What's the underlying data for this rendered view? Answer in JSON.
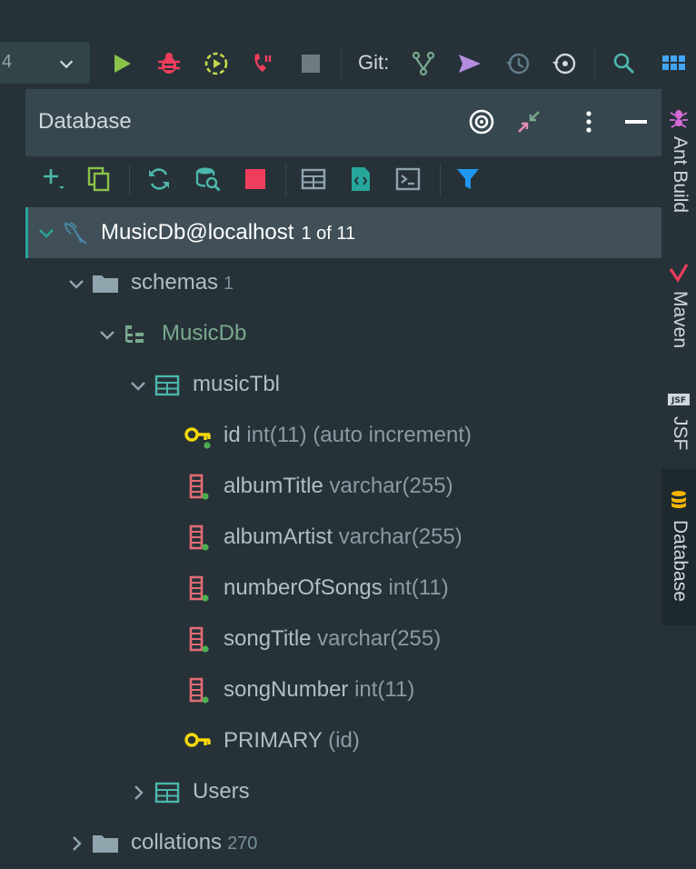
{
  "toolbar": {
    "run_config": "4",
    "git_label": "Git:",
    "icons": [
      "chevron-down-icon",
      "run-icon",
      "debug-icon",
      "coverage-icon",
      "profiler-icon",
      "stop-icon",
      "git-branch-icon",
      "git-push-icon",
      "history-icon",
      "revert-icon",
      "search-icon",
      "apps-grid-icon"
    ]
  },
  "panel": {
    "title": "Database",
    "header_icons": [
      "target-icon",
      "collapse-icon",
      "more-vertical-icon",
      "minimize-icon"
    ],
    "db_toolbar_icons": [
      "add-icon",
      "duplicate-icon",
      "refresh-icon",
      "schema-search-icon",
      "stop-icon",
      "table-view-icon",
      "ddl-file-icon",
      "console-icon",
      "filter-icon"
    ]
  },
  "tree": {
    "connection": {
      "name": "MusicDb@localhost",
      "count": "1 of 11"
    },
    "schemas": {
      "name": "schemas",
      "count": "1"
    },
    "schema": {
      "name": "MusicDb"
    },
    "table": {
      "name": "musicTbl"
    },
    "columns": [
      {
        "name": "id",
        "type": "int(11) (auto increment)",
        "icon": "key-icon"
      },
      {
        "name": "albumTitle",
        "type": "varchar(255)",
        "icon": "column-icon"
      },
      {
        "name": "albumArtist",
        "type": "varchar(255)",
        "icon": "column-icon"
      },
      {
        "name": "numberOfSongs",
        "type": "int(11)",
        "icon": "column-icon"
      },
      {
        "name": "songTitle",
        "type": "varchar(255)",
        "icon": "column-icon"
      },
      {
        "name": "songNumber",
        "type": "int(11)",
        "icon": "column-icon"
      }
    ],
    "primary_key": {
      "name": "PRIMARY",
      "type": "(id)"
    },
    "table2": {
      "name": "Users"
    },
    "collations": {
      "name": "collations",
      "count": "270"
    }
  },
  "right_tabs": [
    {
      "label": "Ant Build",
      "icon": "ant-icon"
    },
    {
      "label": "Maven",
      "icon": "maven-icon"
    },
    {
      "label": "JSF",
      "icon": "jsf-icon"
    },
    {
      "label": "Database",
      "icon": "database-icon",
      "active": true
    }
  ],
  "colors": {
    "background": "#263238",
    "header": "#37474f",
    "selection": "#415058",
    "accent": "#26a69a",
    "run": "#8bc34a",
    "debug": "#ef3e5c",
    "key": "#f5d90a",
    "column": "#e06c75"
  }
}
